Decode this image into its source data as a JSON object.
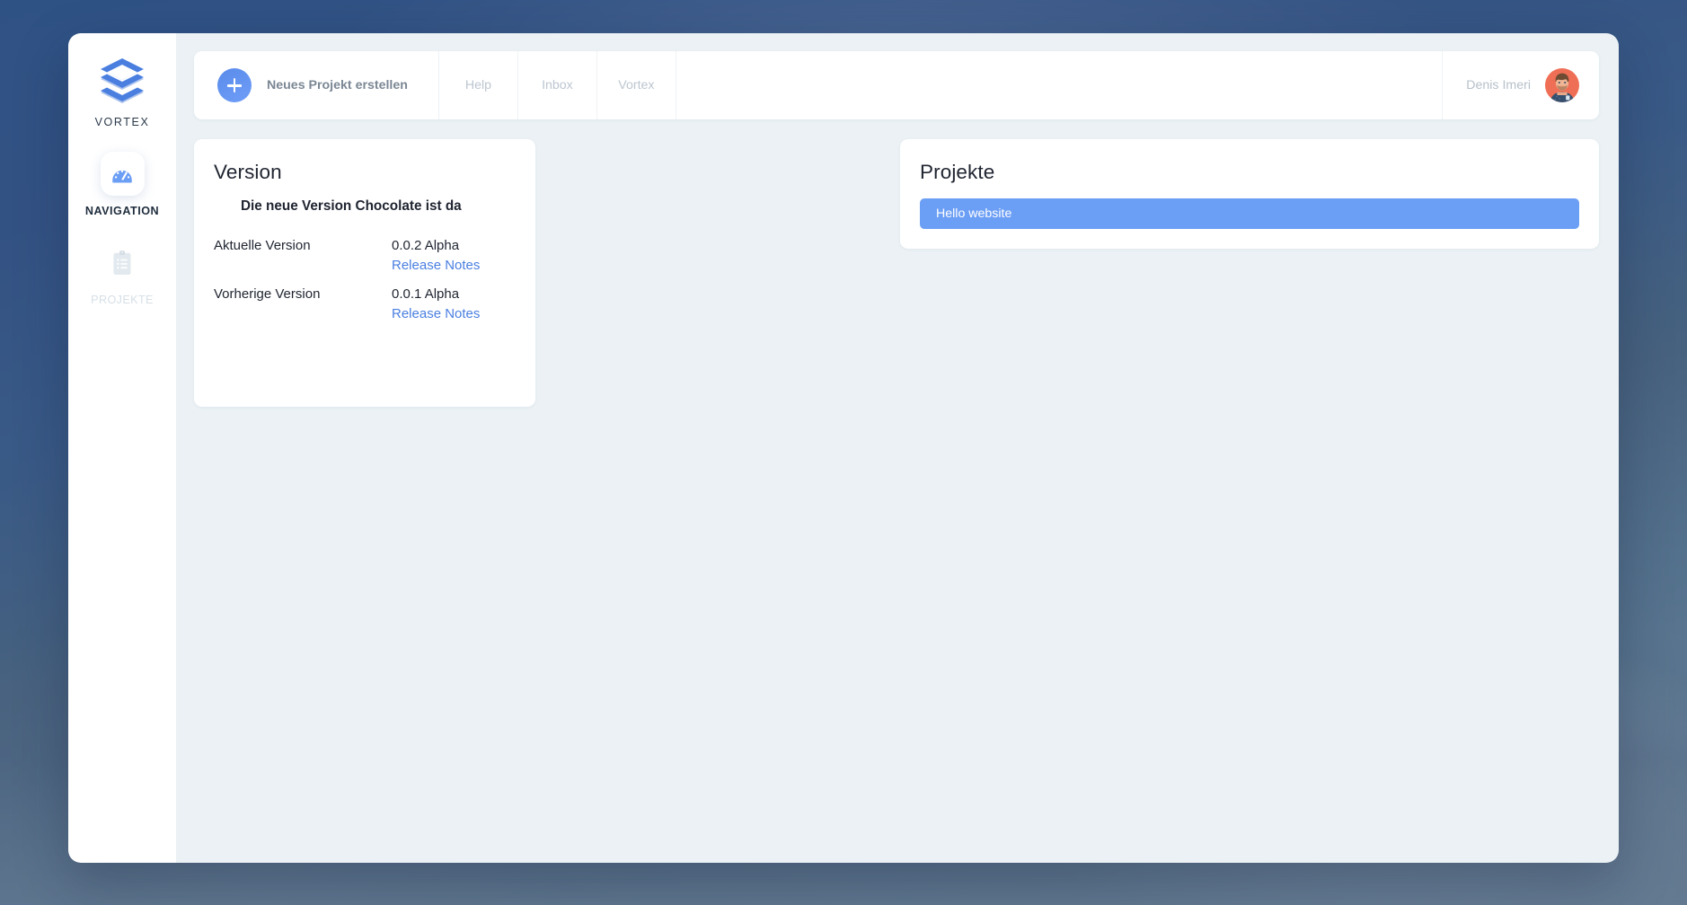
{
  "sidebar": {
    "brand_name": "VORTEX",
    "brand_logo_icon": "vortex-layers-logo",
    "items": [
      {
        "label": "NAVIGATION",
        "icon": "speedometer-dashboard-icon",
        "active": true
      },
      {
        "label": "PROJEKTE",
        "icon": "clipboard-list-icon",
        "active": false
      }
    ]
  },
  "topbar": {
    "create_project_label": "Neues Projekt erstellen",
    "create_project_icon": "plus-icon",
    "links": [
      {
        "label": "Help"
      },
      {
        "label": "Inbox"
      },
      {
        "label": "Vortex"
      }
    ],
    "user": {
      "name": "Denis Imeri",
      "avatar_icon": "user-avatar"
    }
  },
  "version_card": {
    "title": "Version",
    "subtitle": "Die neue Version Chocolate ist da",
    "rows": [
      {
        "key": "Aktuelle Version",
        "value": "0.0.2 Alpha",
        "link": "Release Notes"
      },
      {
        "key": "Vorherige Version",
        "value": "0.0.1 Alpha",
        "link": "Release Notes"
      }
    ]
  },
  "projects_card": {
    "title": "Projekte",
    "items": [
      {
        "label": "Hello website"
      }
    ]
  },
  "colors": {
    "accent_blue": "#6b9ef5",
    "link_blue": "#4a7fe0",
    "content_bg": "#ebf1f4",
    "card_bg": "#ffffff",
    "desktop_bg": "#3d5a80",
    "muted_text": "#bcc6d0"
  }
}
